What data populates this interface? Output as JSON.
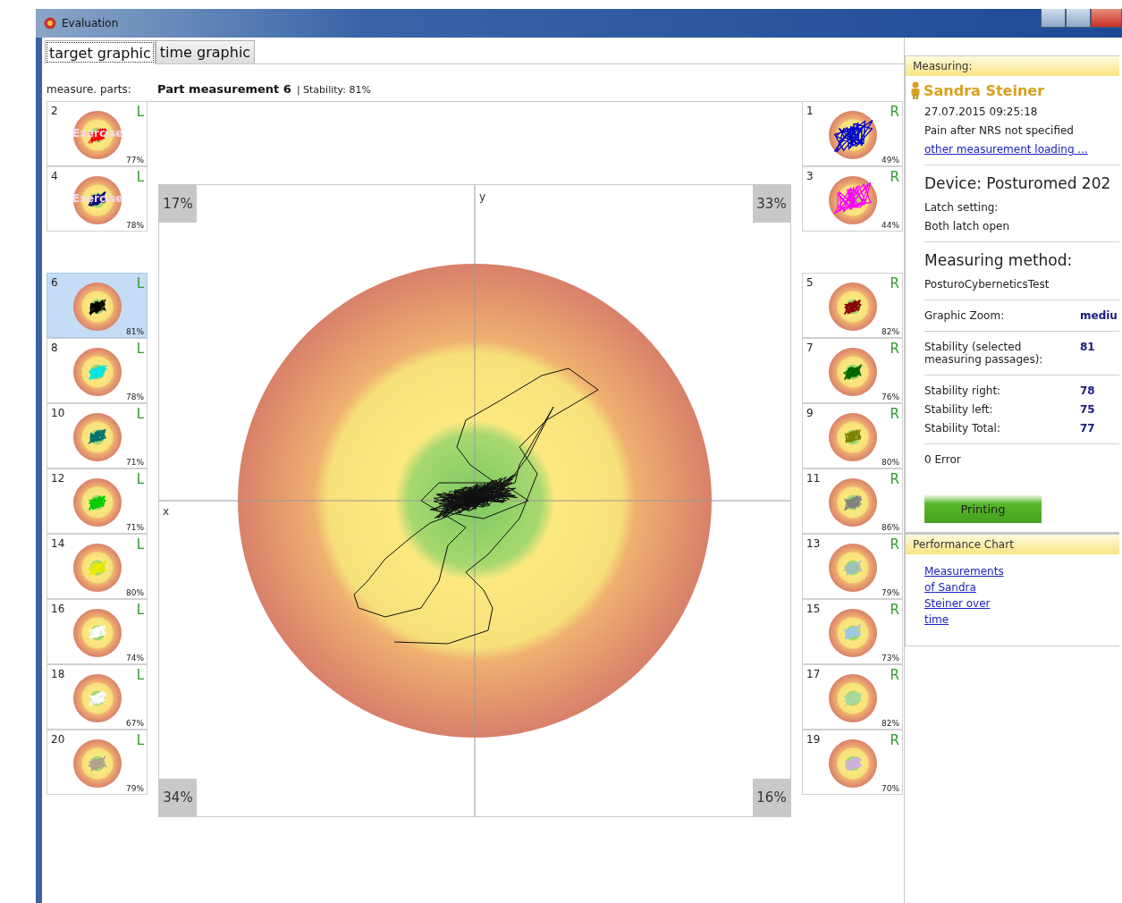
{
  "window": {
    "title": "Evaluation"
  },
  "tabs": [
    {
      "label": "target graphic",
      "selected": true
    },
    {
      "label": "time graphic",
      "selected": false
    }
  ],
  "parts_label": "measure. parts:",
  "heading": {
    "title": "Part measurement 6",
    "stability": "| Stability: 81%"
  },
  "left_parts": [
    {
      "number": "2",
      "side": "L",
      "percent": "77%",
      "color": "#ff0000",
      "selected": false,
      "overlay": "Exercise"
    },
    {
      "number": "4",
      "side": "L",
      "percent": "78%",
      "color": "#000080",
      "selected": false,
      "overlay": "Exercise"
    },
    {
      "number": "6",
      "side": "L",
      "percent": "81%",
      "color": "#000000",
      "selected": true
    },
    {
      "number": "8",
      "side": "L",
      "percent": "78%",
      "color": "#00e5e5",
      "selected": false
    },
    {
      "number": "10",
      "side": "L",
      "percent": "71%",
      "color": "#007070",
      "selected": false
    },
    {
      "number": "12",
      "side": "L",
      "percent": "71%",
      "color": "#00cc00",
      "selected": false
    },
    {
      "number": "14",
      "side": "L",
      "percent": "80%",
      "color": "#e8e800",
      "selected": false
    },
    {
      "number": "16",
      "side": "L",
      "percent": "74%",
      "color": "#ffffff",
      "selected": false
    },
    {
      "number": "18",
      "side": "L",
      "percent": "67%",
      "color": "#fafafa",
      "selected": false
    },
    {
      "number": "20",
      "side": "L",
      "percent": "79%",
      "color": "#b0a090",
      "selected": false
    }
  ],
  "right_parts": [
    {
      "number": "1",
      "side": "R",
      "percent": "49%",
      "color": "#0000cc",
      "selected": false
    },
    {
      "number": "3",
      "side": "R",
      "percent": "44%",
      "color": "#ff00ff",
      "selected": false
    },
    {
      "number": "5",
      "side": "R",
      "percent": "82%",
      "color": "#8b0000",
      "selected": false
    },
    {
      "number": "7",
      "side": "R",
      "percent": "76%",
      "color": "#006400",
      "selected": false
    },
    {
      "number": "9",
      "side": "R",
      "percent": "80%",
      "color": "#808000",
      "selected": false
    },
    {
      "number": "11",
      "side": "R",
      "percent": "86%",
      "color": "#808080",
      "selected": false
    },
    {
      "number": "13",
      "side": "R",
      "percent": "79%",
      "color": "#a0c0c0",
      "selected": false
    },
    {
      "number": "15",
      "side": "R",
      "percent": "73%",
      "color": "#a0c8e8",
      "selected": false
    },
    {
      "number": "17",
      "side": "R",
      "percent": "82%",
      "color": "#a8d8a0",
      "selected": false
    },
    {
      "number": "19",
      "side": "R",
      "percent": "70%",
      "color": "#d0b0e0",
      "selected": false
    }
  ],
  "chart": {
    "y_label": "y",
    "x_label": "x",
    "corners": [
      "17%",
      "33%",
      "34%",
      "16%"
    ]
  },
  "info": {
    "header": "Measuring:",
    "patient": "Sandra Steiner",
    "datetime": "27.07.2015 09:25:18",
    "pain": "Pain after NRS not specified",
    "load_link": "other measurement loading ...",
    "device": "Device: Posturomed 202",
    "latch_label": "Latch setting:",
    "latch_value": "Both latch open",
    "method_title": "Measuring method:",
    "method_value": "PosturoCyberneticsTest",
    "stat_groups": [
      [
        {
          "label": "Graphic Zoom:",
          "value": "mediu"
        }
      ],
      [
        {
          "label": "Stability (selected measuring passages):",
          "value": "81"
        }
      ],
      [
        {
          "label": "Stability right:",
          "value": "78"
        },
        {
          "label": "Stability left:",
          "value": "75"
        },
        {
          "label": "Stability Total:",
          "value": "77"
        }
      ]
    ],
    "error": "0 Error",
    "print_button": "Printing"
  },
  "performance": {
    "header": "Performance Chart",
    "link": "Measurements of Sandra Steiner over time"
  }
}
